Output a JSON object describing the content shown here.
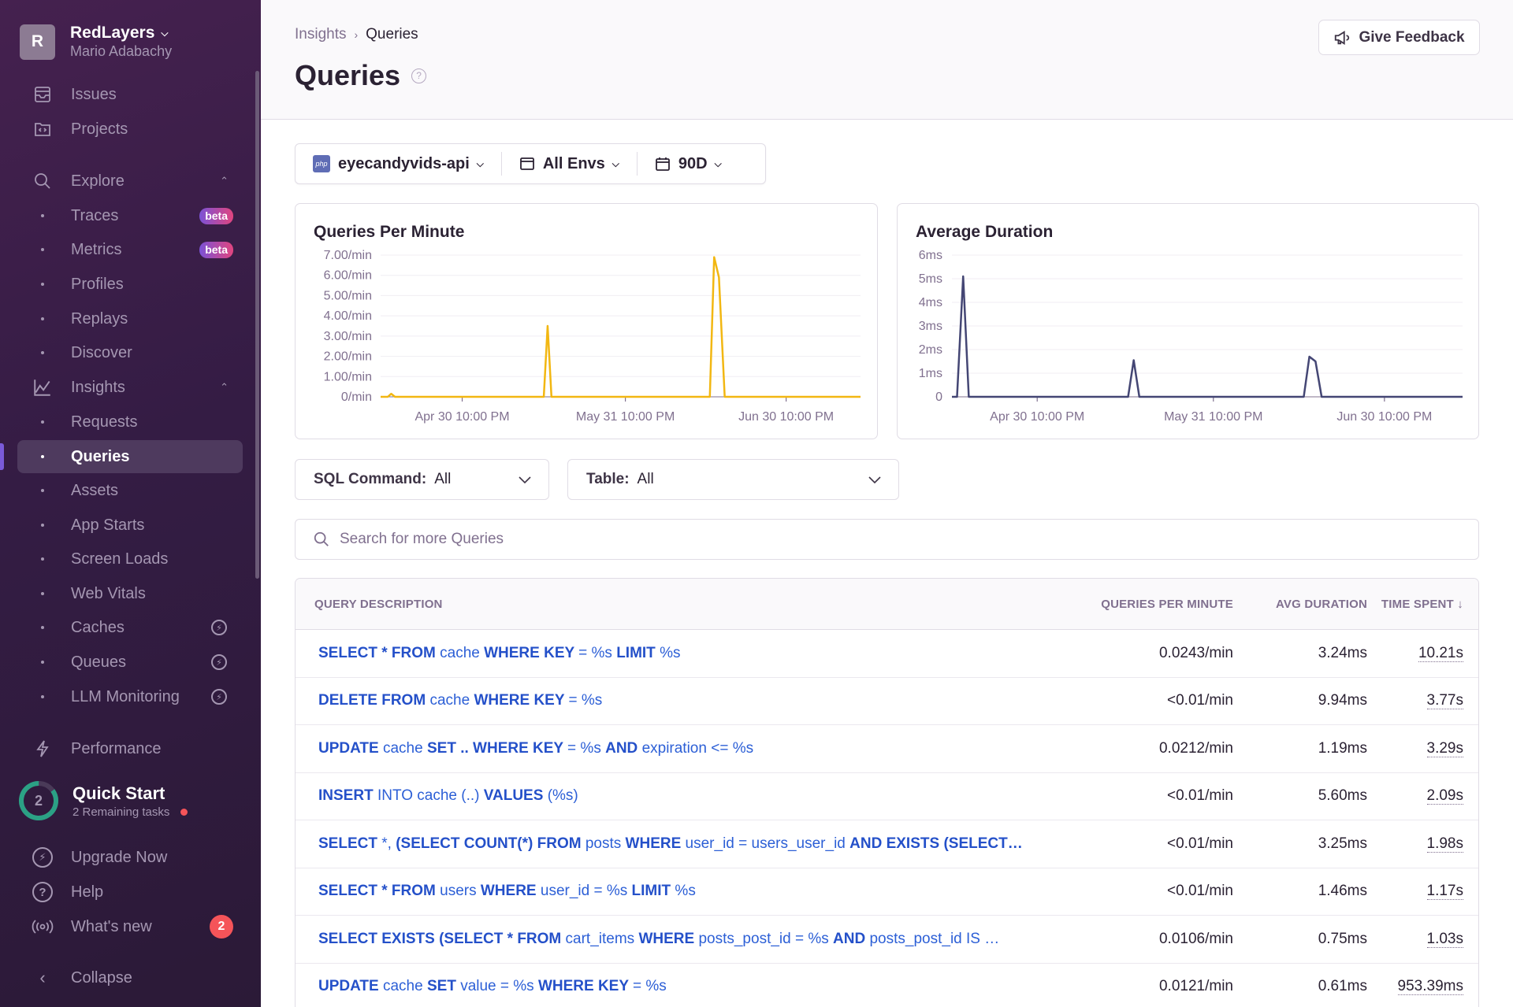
{
  "sidebar": {
    "org": {
      "initial": "R",
      "name": "RedLayers",
      "user": "Mario Adabachy"
    },
    "items": [
      {
        "label": "Issues",
        "icon": "inbox-icon"
      },
      {
        "label": "Projects",
        "icon": "folder-code-icon"
      },
      {
        "label": "Explore",
        "icon": "search-icon"
      },
      {
        "label": "Traces",
        "badge": "beta"
      },
      {
        "label": "Metrics",
        "badge": "beta"
      },
      {
        "label": "Profiles"
      },
      {
        "label": "Replays"
      },
      {
        "label": "Discover"
      },
      {
        "label": "Insights",
        "icon": "line-chart-icon"
      },
      {
        "label": "Requests"
      },
      {
        "label": "Queries",
        "active": true
      },
      {
        "label": "Assets"
      },
      {
        "label": "App Starts"
      },
      {
        "label": "Screen Loads"
      },
      {
        "label": "Web Vitals"
      },
      {
        "label": "Caches",
        "icon_right": "upgrade-bolt-icon"
      },
      {
        "label": "Queues",
        "icon_right": "upgrade-bolt-icon"
      },
      {
        "label": "LLM Monitoring",
        "icon_right": "upgrade-bolt-icon"
      },
      {
        "label": "Performance",
        "icon": "lightning-icon"
      }
    ],
    "quick_start": {
      "count": "2",
      "title": "Quick Start",
      "subtitle": "2 Remaining tasks",
      "progress_fraction": 0.85
    },
    "footer": [
      {
        "label": "Upgrade Now",
        "icon": "bolt-circle-icon"
      },
      {
        "label": "Help",
        "icon": "question-circle-icon"
      },
      {
        "label": "What's new",
        "icon": "broadcast-icon",
        "badge": "2"
      },
      {
        "label": "Collapse",
        "icon": "chevron-left-icon"
      }
    ]
  },
  "header": {
    "breadcrumb": [
      "Insights",
      "Queries"
    ],
    "title": "Queries",
    "feedback_label": "Give Feedback"
  },
  "filters": {
    "project": {
      "icon": "php",
      "label": "eyecandyvids-api"
    },
    "environment": "All Envs",
    "period": "90D"
  },
  "selects": {
    "sql_command": {
      "label": "SQL Command:",
      "value": "All"
    },
    "table": {
      "label": "Table:",
      "value": "All"
    }
  },
  "search": {
    "placeholder": "Search for more Queries",
    "value": ""
  },
  "chart_data": [
    {
      "type": "line",
      "title": "Queries Per Minute",
      "color": "#f2b712",
      "ylim": [
        0,
        7
      ],
      "yticks": [
        "0/min",
        "1.00/min",
        "2.00/min",
        "3.00/min",
        "4.00/min",
        "5.00/min",
        "6.00/min",
        "7.00/min"
      ],
      "xticks": [
        {
          "label": "Apr 30 10:00 PM",
          "x": 0.17
        },
        {
          "label": "May 31 10:00 PM",
          "x": 0.51
        },
        {
          "label": "Jun 30 10:00 PM",
          "x": 0.845
        }
      ],
      "series": [
        {
          "name": "spm()",
          "points": [
            [
              0,
              0
            ],
            [
              0.015,
              0
            ],
            [
              0.022,
              0.15
            ],
            [
              0.03,
              0
            ],
            [
              0.34,
              0
            ],
            [
              0.348,
              3.5
            ],
            [
              0.356,
              0
            ],
            [
              0.686,
              0
            ],
            [
              0.695,
              6.9
            ],
            [
              0.705,
              5.9
            ],
            [
              0.717,
              0
            ],
            [
              1,
              0
            ]
          ]
        }
      ],
      "grid": true
    },
    {
      "type": "line",
      "title": "Average Duration",
      "color": "#444674",
      "ylim": [
        0,
        6
      ],
      "yticks": [
        "0",
        "1ms",
        "2ms",
        "3ms",
        "4ms",
        "5ms",
        "6ms"
      ],
      "xticks": [
        {
          "label": "Apr 30 10:00 PM",
          "x": 0.167
        },
        {
          "label": "May 31 10:00 PM",
          "x": 0.512
        },
        {
          "label": "Jun 30 10:00 PM",
          "x": 0.847
        }
      ],
      "series": [
        {
          "name": "avg(span.self_time)",
          "points": [
            [
              0,
              0
            ],
            [
              0.01,
              0
            ],
            [
              0.022,
              5.1
            ],
            [
              0.033,
              0
            ],
            [
              0.345,
              0
            ],
            [
              0.356,
              1.55
            ],
            [
              0.367,
              0
            ],
            [
              0.689,
              0
            ],
            [
              0.7,
              1.7
            ],
            [
              0.712,
              1.5
            ],
            [
              0.724,
              0
            ],
            [
              1,
              0
            ]
          ]
        }
      ],
      "grid": true
    }
  ],
  "table": {
    "columns": [
      "QUERY DESCRIPTION",
      "QUERIES PER MINUTE",
      "AVG DURATION",
      "TIME SPENT"
    ],
    "sort_indicator": "↓",
    "rows": [
      {
        "description": [
          [
            "k",
            "SELECT * FROM "
          ],
          [
            "t",
            "cache "
          ],
          [
            "k",
            "WHERE KEY "
          ],
          [
            "t",
            "= %s "
          ],
          [
            "k",
            "LIMIT "
          ],
          [
            "t",
            "%s"
          ]
        ],
        "qpm": "0.0243/min",
        "avg": "3.24ms",
        "time": "10.21s"
      },
      {
        "description": [
          [
            "k",
            "DELETE FROM "
          ],
          [
            "t",
            "cache "
          ],
          [
            "k",
            "WHERE KEY "
          ],
          [
            "t",
            "= %s"
          ]
        ],
        "qpm": "<0.01/min",
        "avg": "9.94ms",
        "time": "3.77s"
      },
      {
        "description": [
          [
            "k",
            "UPDATE "
          ],
          [
            "t",
            "cache "
          ],
          [
            "k",
            "SET .. WHERE KEY "
          ],
          [
            "t",
            "= %s "
          ],
          [
            "k",
            "AND "
          ],
          [
            "t",
            "expiration <= %s"
          ]
        ],
        "qpm": "0.0212/min",
        "avg": "1.19ms",
        "time": "3.29s"
      },
      {
        "description": [
          [
            "k",
            "INSERT "
          ],
          [
            "t",
            "INTO cache (..) "
          ],
          [
            "k",
            "VALUES "
          ],
          [
            "t",
            "(%s)"
          ]
        ],
        "qpm": "<0.01/min",
        "avg": "5.60ms",
        "time": "2.09s"
      },
      {
        "description": [
          [
            "k",
            "SELECT "
          ],
          [
            "t",
            "*, "
          ],
          [
            "k",
            "(SELECT COUNT(*) FROM "
          ],
          [
            "t",
            "posts "
          ],
          [
            "k",
            "WHERE "
          ],
          [
            "t",
            "user_id = users_user_id "
          ],
          [
            "k",
            "AND EXISTS (SELECT…"
          ]
        ],
        "qpm": "<0.01/min",
        "avg": "3.25ms",
        "time": "1.98s"
      },
      {
        "description": [
          [
            "k",
            "SELECT * FROM "
          ],
          [
            "t",
            "users "
          ],
          [
            "k",
            "WHERE "
          ],
          [
            "t",
            "user_id = %s "
          ],
          [
            "k",
            "LIMIT "
          ],
          [
            "t",
            "%s"
          ]
        ],
        "qpm": "<0.01/min",
        "avg": "1.46ms",
        "time": "1.17s"
      },
      {
        "description": [
          [
            "k",
            "SELECT EXISTS (SELECT * FROM "
          ],
          [
            "t",
            "cart_items "
          ],
          [
            "k",
            "WHERE "
          ],
          [
            "t",
            "posts_post_id = %s "
          ],
          [
            "k",
            "AND "
          ],
          [
            "t",
            "posts_post_id IS …"
          ]
        ],
        "qpm": "0.0106/min",
        "avg": "0.75ms",
        "time": "1.03s"
      },
      {
        "description": [
          [
            "k",
            "UPDATE "
          ],
          [
            "t",
            "cache "
          ],
          [
            "k",
            "SET "
          ],
          [
            "t",
            "value = %s "
          ],
          [
            "k",
            "WHERE KEY "
          ],
          [
            "t",
            "= %s"
          ]
        ],
        "qpm": "0.0121/min",
        "avg": "0.61ms",
        "time": "953.39ms"
      }
    ]
  }
}
